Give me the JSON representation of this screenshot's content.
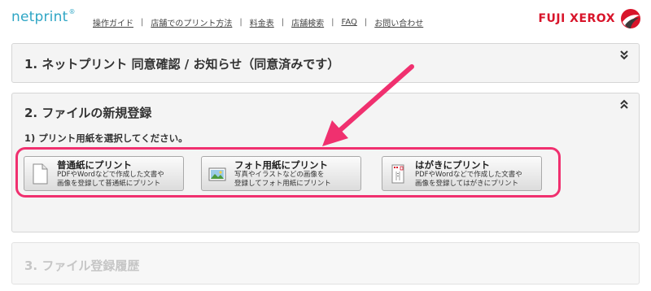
{
  "header": {
    "logo_text": "netprint",
    "logo_mark": "®",
    "nav": [
      "操作ガイド",
      "店舗でのプリント方法",
      "料金表",
      "店舗検索",
      "FAQ",
      "お問い合わせ"
    ],
    "nav_separator": "|",
    "brand": "FUJI XEROX"
  },
  "panels": {
    "p1": {
      "title": "1. ネットプリント 同意確認 / お知らせ（同意済みです）",
      "toggle_icon": "chevron-double-down-icon"
    },
    "p2": {
      "title": "2. ファイルの新規登録",
      "toggle_icon": "chevron-double-up-icon",
      "subtitle": "1) プリント用紙を選択してください。",
      "buttons": [
        {
          "title": "普通紙にプリント",
          "line1": "PDFやWordなどで作成した文書や",
          "line2": "画像を登録して普通紙にプリント",
          "icon": "document-icon"
        },
        {
          "title": "フォト用紙にプリント",
          "line1": "写真やイラストなどの画像を",
          "line2": "登録してフォト用紙にプリント",
          "icon": "photo-icon"
        },
        {
          "title": "はがきにプリント",
          "line1": "PDFやWordなどで作成した文書や",
          "line2": "画像を登録してはがきにプリント",
          "icon": "postcard-icon"
        }
      ]
    },
    "p3": {
      "title": "3. ファイル登録履歴"
    }
  },
  "colors": {
    "logo": "#2fa6c5",
    "brand": "#d8142a",
    "highlight": "#f0306f"
  }
}
